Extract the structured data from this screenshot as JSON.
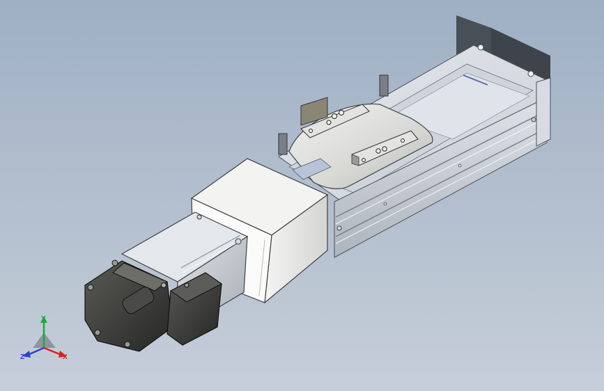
{
  "viewport": {
    "background_top": "#9fb0c4",
    "background_bottom": "#c6ced9",
    "model": "linear-actuator-module"
  },
  "triad": {
    "x_label": "X",
    "y_label": "Y",
    "z_label": "Z",
    "x_color": "#d92020",
    "y_color": "#1fa83a",
    "z_color": "#2a45c8"
  }
}
